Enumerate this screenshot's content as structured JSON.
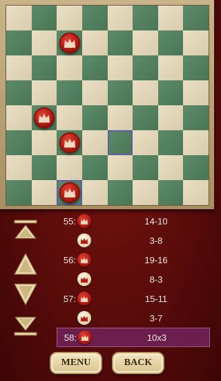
{
  "board": {
    "size": 8,
    "highlighted_squares": [
      {
        "row": 5,
        "col": 4
      },
      {
        "row": 7,
        "col": 2
      }
    ],
    "pieces": [
      {
        "row": 1,
        "col": 2,
        "color": "red",
        "icon": "crown-icon"
      },
      {
        "row": 4,
        "col": 1,
        "color": "red",
        "icon": "crown-icon"
      },
      {
        "row": 5,
        "col": 2,
        "color": "red",
        "icon": "crown-icon"
      },
      {
        "row": 7,
        "col": 2,
        "color": "red",
        "icon": "crown-icon"
      }
    ]
  },
  "controls": {
    "first_icon": "skip-to-start-icon",
    "prev_icon": "up-triangle-icon",
    "next_icon": "down-triangle-icon",
    "last_icon": "skip-to-end-icon"
  },
  "moves": [
    {
      "num": "55:",
      "piece": "red",
      "move": "14-10",
      "selected": false
    },
    {
      "num": "",
      "piece": "white",
      "move": "3-8",
      "selected": false
    },
    {
      "num": "56:",
      "piece": "red",
      "move": "19-16",
      "selected": false
    },
    {
      "num": "",
      "piece": "white",
      "move": "8-3",
      "selected": false
    },
    {
      "num": "57:",
      "piece": "red",
      "move": "15-11",
      "selected": false
    },
    {
      "num": "",
      "piece": "white",
      "move": "3-7",
      "selected": false
    },
    {
      "num": "58:",
      "piece": "red",
      "move": "10x3",
      "selected": true
    }
  ],
  "buttons": {
    "menu_label": "MENU",
    "back_label": "BACK"
  },
  "colors": {
    "background": "#5a0c0a",
    "dark_square": "#4a7656",
    "light_square": "#e9dfc3",
    "red_piece": "#b01a12",
    "selected_row": "#6c1f4f"
  }
}
